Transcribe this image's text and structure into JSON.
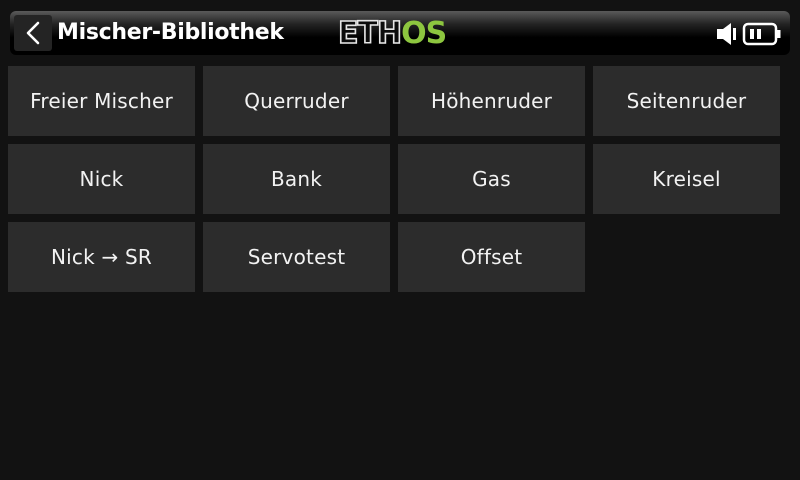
{
  "header": {
    "title": "Mischer-Bibliothek",
    "logo_left": "ETH",
    "logo_right": "OS",
    "back_icon": "chevron-left-icon",
    "speaker_icon": "speaker-icon",
    "battery_icon": "battery-icon"
  },
  "colors": {
    "logo_accent": "#8dc63f",
    "tile_background": "#2c2c2c",
    "screen_background": "#121212"
  },
  "mixers": [
    "Freier Mischer",
    "Querruder",
    "Höhenruder",
    "Seitenruder",
    "Nick",
    "Bank",
    "Gas",
    "Kreisel",
    "Nick → SR",
    "Servotest",
    "Offset"
  ]
}
